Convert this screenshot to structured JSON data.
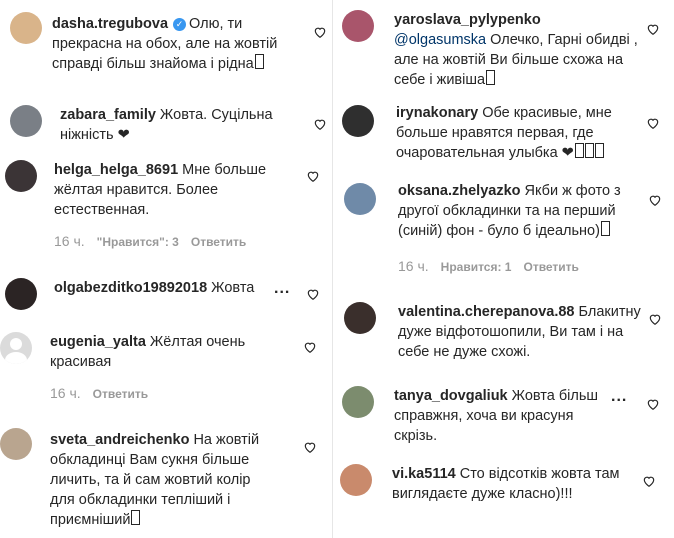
{
  "left": [
    {
      "user": "dasha.tregubova",
      "verified": true,
      "text": "Олю, ти прекрасна на обох, але на жовтій справді більш знайома і рідна",
      "tofu": 1,
      "avatar": "#d9b48a"
    },
    {
      "user": "zabara_family",
      "text": "Жовта. Суцільна ніжність ❤",
      "avatar": "#7a7f86"
    },
    {
      "user": "helga_helga_8691",
      "text": "Мне больше жёлтая нравится. Более естественная.",
      "avatar": "#3b3436",
      "meta": {
        "time": "16 ч.",
        "likes": "\"Нравится\": 3",
        "reply": "Ответить"
      }
    },
    {
      "user": "olgabezditko19892018",
      "text": "Жовта",
      "avatar": "#2b2424",
      "dots": "..."
    },
    {
      "user": "eugenia_yalta",
      "text": "Жёлтая очень красивая",
      "avatar": "default",
      "meta": {
        "time": "16 ч.",
        "reply": "Ответить"
      }
    },
    {
      "user": "sveta_andreichenko",
      "text": "На жовтій обкладинці Вам сукня більше личить, та й сам жовтий колір для обкладинки тепліший і приємніший",
      "tofu": 1,
      "avatar": "#b9a58f"
    }
  ],
  "right": [
    {
      "user": "yaroslava_pylypenko",
      "mention": "@olgasumska",
      "text": "Олечко, Гарні обидві , але на жовтій Ви більше схожа на себе і живіша",
      "tofu": 1,
      "avatar": "#a9556b"
    },
    {
      "user": "irynakonary",
      "text": "Обе красивые, мне больше нравятся первая, где очаровательная улыбка ❤",
      "tofu": 3,
      "avatar": "#2f2f2f"
    },
    {
      "user": "oksana.zhelyazko",
      "text": "Якби ж фото з другої обкладинки та на перший (синій) фон - було б ідеально)",
      "tofu": 1,
      "avatar": "#6f8aa8",
      "meta": {
        "time": "16 ч.",
        "likes": "Нравится: 1",
        "reply": "Ответить"
      }
    },
    {
      "user": "valentina.cherepanova.88",
      "text": "Блакитну дуже відфотошопили, Ви там і на себе не дуже схожі.",
      "avatar": "#3a2f2c"
    },
    {
      "user": "tanya_dovgaliuk",
      "text": "Жовта більш справжня, хоча ви красуня скрізь.",
      "avatar": "#7c8c6e",
      "dots": "..."
    },
    {
      "user": "vi.ka5114",
      "text": "Сто відсотків жовта там виглядаєте дуже класно)!!!",
      "avatar": "#c98a6c"
    }
  ]
}
